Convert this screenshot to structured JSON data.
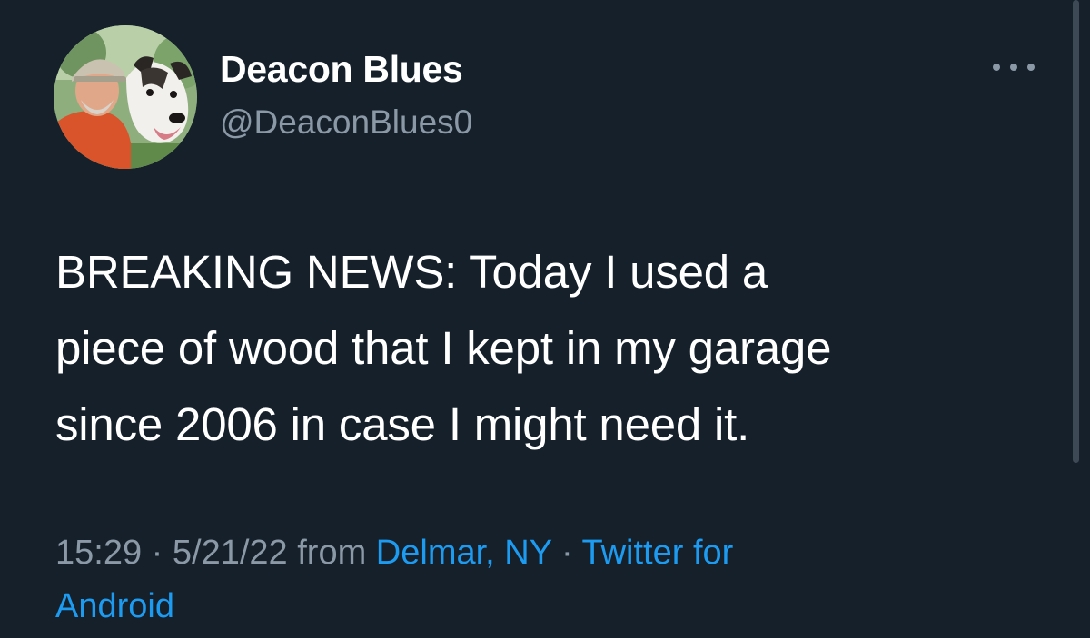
{
  "tweet": {
    "display_name": "Deacon Blues",
    "handle": "@DeaconBlues0",
    "text_lines": [
      "BREAKING NEWS: Today I used a",
      "piece of wood that I kept in my garage",
      "since 2006 in case I might need it."
    ],
    "time": "15:29",
    "separator": "·",
    "date": "5/21/22",
    "from_label": "from",
    "location": "Delmar, NY",
    "source_line1": "Twitter for",
    "source_line2": "Android"
  },
  "icons": {
    "more": "more-horizontal-icon"
  },
  "colors": {
    "background": "#15202b",
    "text_primary": "#ffffff",
    "text_secondary": "#8b98a5",
    "link": "#1d9bf0"
  }
}
